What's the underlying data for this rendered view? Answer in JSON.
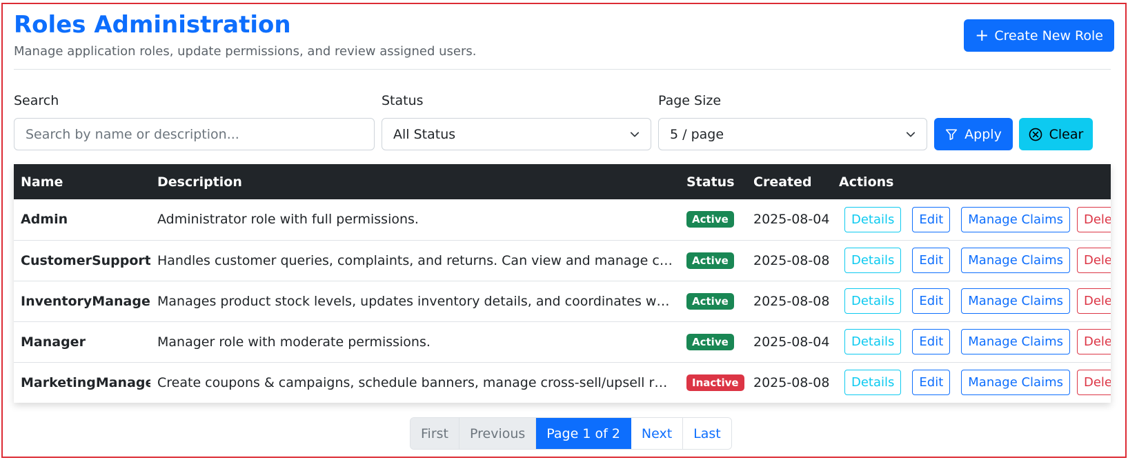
{
  "header": {
    "title": "Roles Administration",
    "subtitle": "Manage application roles, update permissions, and review assigned users.",
    "create_button": "Create New Role"
  },
  "filters": {
    "search_label": "Search",
    "search_placeholder": "Search by name or description...",
    "search_value": "",
    "status_label": "Status",
    "status_value": "All Status",
    "pagesize_label": "Page Size",
    "pagesize_value": "5 / page",
    "apply_label": "Apply",
    "clear_label": "Clear"
  },
  "table": {
    "columns": [
      "Name",
      "Description",
      "Status",
      "Created",
      "Actions"
    ],
    "action_labels": {
      "details": "Details",
      "edit": "Edit",
      "claims": "Manage Claims",
      "delete": "Delete"
    },
    "rows": [
      {
        "name": "Admin",
        "description": "Administrator role with full permissions.",
        "status": "Active",
        "created": "2025-08-04"
      },
      {
        "name": "CustomerSupport",
        "description": "Handles customer queries, complaints, and returns. Can view and manage custom...",
        "status": "Active",
        "created": "2025-08-08"
      },
      {
        "name": "InventoryManager",
        "description": "Manages product stock levels, updates inventory details, and coordinates with...",
        "status": "Active",
        "created": "2025-08-08"
      },
      {
        "name": "Manager",
        "description": "Manager role with moderate permissions.",
        "status": "Active",
        "created": "2025-08-04"
      },
      {
        "name": "MarketingManager",
        "description": "Create coupons & campaigns, schedule banners, manage cross-sell/upsell rules,...",
        "status": "Inactive",
        "created": "2025-08-08"
      }
    ]
  },
  "status_colors": {
    "Active": "#198754",
    "Inactive": "#dc3545"
  },
  "pagination": {
    "first": "First",
    "previous": "Previous",
    "current": "Page 1 of 2",
    "next": "Next",
    "last": "Last"
  }
}
